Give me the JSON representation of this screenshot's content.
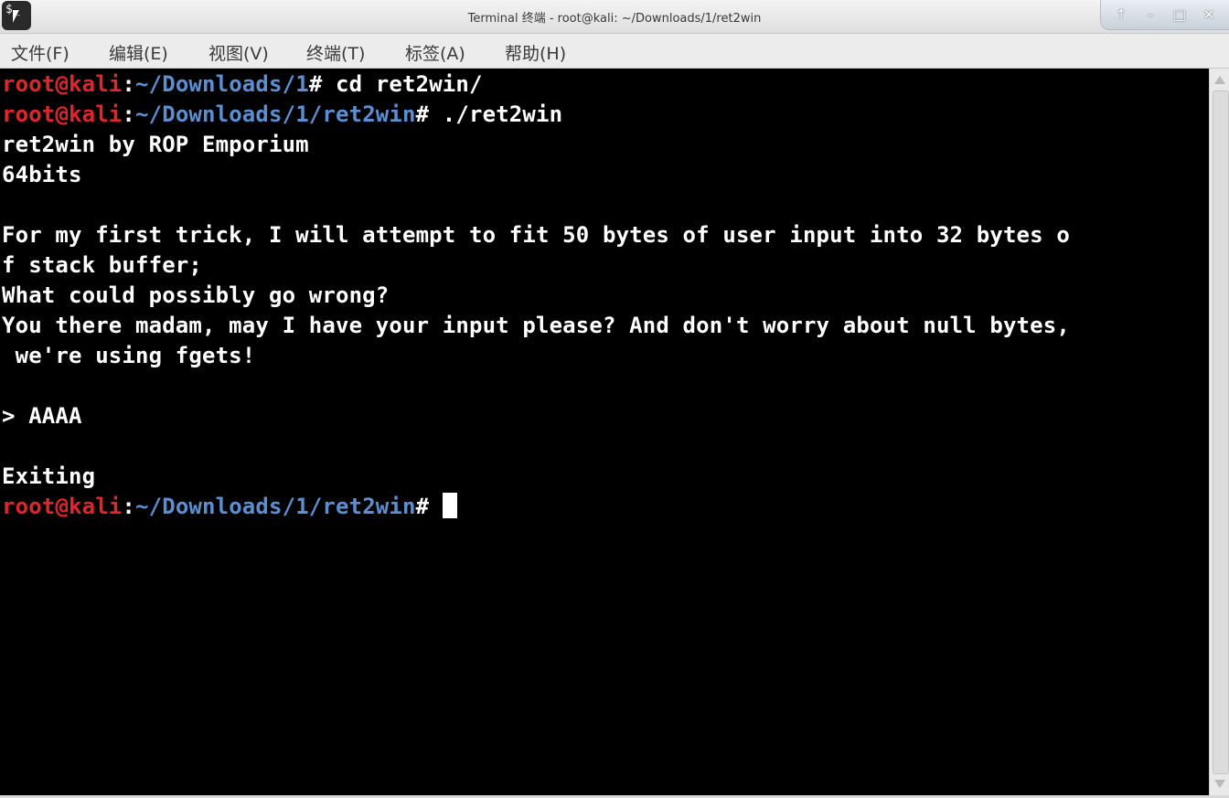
{
  "window": {
    "title": "Terminal 终端 - root@kali: ~/Downloads/1/ret2win"
  },
  "controls": {
    "shade": "↑",
    "minimize": "–",
    "maximize": "□",
    "close": "✕"
  },
  "menu": {
    "file": "文件(F)",
    "edit": "编辑(E)",
    "view": "视图(V)",
    "terminal": "终端(T)",
    "tabs": "标签(A)",
    "help": "帮助(H)"
  },
  "terminal": {
    "prompt1": {
      "user": "root@kali",
      "colon": ":",
      "path": "~/Downloads/1",
      "command": "# cd ret2win/"
    },
    "prompt2": {
      "user": "root@kali",
      "colon": ":",
      "path": "~/Downloads/1/ret2win",
      "command": "# ./ret2win"
    },
    "output": [
      "ret2win by ROP Emporium",
      "64bits",
      "",
      "For my first trick, I will attempt to fit 50 bytes of user input into 32 bytes o",
      "f stack buffer;",
      "What could possibly go wrong?",
      "You there madam, may I have your input please? And don't worry about null bytes,",
      " we're using fgets!",
      "",
      "> AAAA",
      "",
      "Exiting"
    ],
    "prompt3": {
      "user": "root@kali",
      "colon": ":",
      "path": "~/Downloads/1/ret2win",
      "command": "# "
    }
  },
  "icons": {
    "app": "terminal-icon",
    "pointer": "mouse-pointer-icon"
  }
}
